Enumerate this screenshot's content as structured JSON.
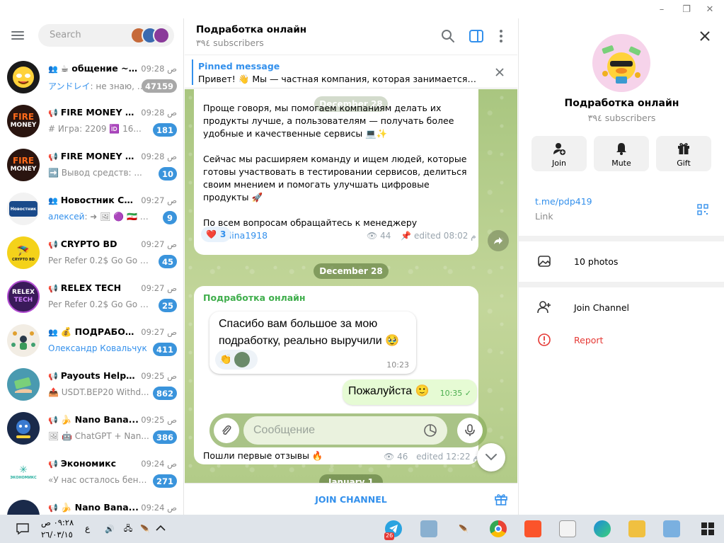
{
  "window": {
    "minimize": "–",
    "restore": "❐",
    "close": "✕"
  },
  "search": {
    "placeholder": "Search"
  },
  "chats": [
    {
      "type_icon": "group",
      "title": "☕ общение ~ ...",
      "time": "09:28 ص",
      "sender": "アンドレイ",
      "preview": ": не знаю, у ...",
      "badge": "47159",
      "muted": true,
      "avatar_color": "#1a1a1a"
    },
    {
      "type_icon": "channel",
      "title": "FIRE MONEY и...",
      "time": "09:28 ص",
      "sender": "",
      "preview": "# Игра: 2209 🆔 16...",
      "badge": "181",
      "muted": false,
      "avatar_color": "#2a1510"
    },
    {
      "type_icon": "channel",
      "title": "FIRE MONEY ф...",
      "time": "09:28 ص",
      "sender": "",
      "preview": "➡️ Вывод средств: ...",
      "badge": "10",
      "muted": false,
      "avatar_color": "#2a1510"
    },
    {
      "type_icon": "group",
      "title": "Новостник Chat",
      "time": "09:27 ص",
      "sender": "алексей",
      "preview": ": ➜ 🖼 🟣 🇮🇷 Ir...",
      "badge": "9",
      "muted": false,
      "avatar_color": "#f2f2f2"
    },
    {
      "type_icon": "channel",
      "title": "CRYPTO BD",
      "time": "09:27 ص",
      "sender": "",
      "preview": "Per Refer 0.2$ Go Go   ht...",
      "badge": "45",
      "muted": false,
      "avatar_color": "#f4d21a"
    },
    {
      "type_icon": "channel",
      "title": "RELEX TECH",
      "time": "09:27 ص",
      "sender": "",
      "preview": "Per Refer 0.2$ Go Go   ht...",
      "badge": "25",
      "muted": false,
      "avatar_color": "#3a1a5a"
    },
    {
      "type_icon": "group",
      "title": "💰 ПОДРАБОТ...",
      "time": "09:27 ص",
      "sender": "Олександр Ковальчук",
      "preview": "...",
      "badge": "411",
      "muted": false,
      "avatar_color": "#f2ede4"
    },
    {
      "type_icon": "channel",
      "title": "Payouts Helper™",
      "time": "09:25 ص",
      "sender": "",
      "preview": "📤 USDT.BEP20 Withd...",
      "badge": "862",
      "muted": false,
      "avatar_color": "#4a9ab0"
    },
    {
      "type_icon": "channel",
      "title": "🍌 Nano Bana...",
      "time": "09:25 ص",
      "sender": "",
      "preview": "🖼 🤖 ChatGPT + Nan...",
      "badge": "386",
      "muted": false,
      "avatar_color": "#1a2a4a"
    },
    {
      "type_icon": "channel",
      "title": "Экономикс",
      "time": "09:24 ص",
      "sender": "",
      "preview": "«У нас осталось бензи...",
      "badge": "271",
      "muted": false,
      "avatar_color": "#ffffff"
    },
    {
      "type_icon": "channel",
      "title": "🍌 Nano Bana...",
      "time": "09:24 ص",
      "sender": "",
      "preview": "",
      "badge": "",
      "muted": false,
      "avatar_color": "#1a2a4a"
    }
  ],
  "avatar_text": {
    "fire": "FIRE",
    "money": "MONEY",
    "relex": "RELEX",
    "tech": "TECH",
    "crypto": "CRYPTO BD",
    "novost": "Новостник",
    "econ": "ЭКОНОМИКС"
  },
  "channel": {
    "title": "Подработка онлайн",
    "subscribers": "٣٩٤ subscribers"
  },
  "pinned": {
    "label": "Pinned message",
    "text": "Привет! 👋 Мы — частная компания, которая занимается те..."
  },
  "post1": {
    "ghost_chip": "December 28",
    "paragraphs": [
      "Проще говоря, мы помогаем компаниям делать их продукты лучше, а пользователям — получать более удобные и качественные сервисы 💻✨",
      "Сейчас мы расширяем команду и ищем людей, которые готовы участвовать в тестировании сервисов, делиться своим мнением и помогать улучшать цифровые продукты 🚀"
    ],
    "contact_prefix": "По всем вопросам обращайтесь к менеджеру ",
    "mention": "@modina1918",
    "reaction": "❤️",
    "reaction_count": "3",
    "views": "44",
    "edited": "edited 08:02 م"
  },
  "date_chip": "December 28",
  "post2": {
    "author": "Подработка онлайн",
    "quote": "Спасибо вам большое за мою подработку, реально выручили 🥹",
    "quote_time": "10:23",
    "reply": "Пожалуйста 🙂",
    "reply_time": "10:35 ✓",
    "compose_placeholder": "Сообщение",
    "text": "Пошли первые отзывы 🔥",
    "views": "46",
    "edited": "edited 12:22 م"
  },
  "bottom_chip": "January 1",
  "footer": {
    "join": "JOIN CHANNEL"
  },
  "profile": {
    "name": "Подработка онлайн",
    "subscribers": "٣٩٤ subscribers",
    "actions": [
      "Join",
      "Mute",
      "Gift"
    ],
    "link": "t.me/pdp419",
    "link_label": "Link",
    "photos": "10 photos",
    "join_channel": "Join Channel",
    "report": "Report"
  },
  "taskbar": {
    "time": "٠٩:٢٨ ص",
    "date": "٢٦/٠٣/١٥",
    "lang": "ع",
    "tg_badge": "26"
  },
  "colors": {
    "accent": "#3390ec",
    "badge": "#3a94dc",
    "chat_bg": "#b5cd8a",
    "report": "#e53935"
  }
}
